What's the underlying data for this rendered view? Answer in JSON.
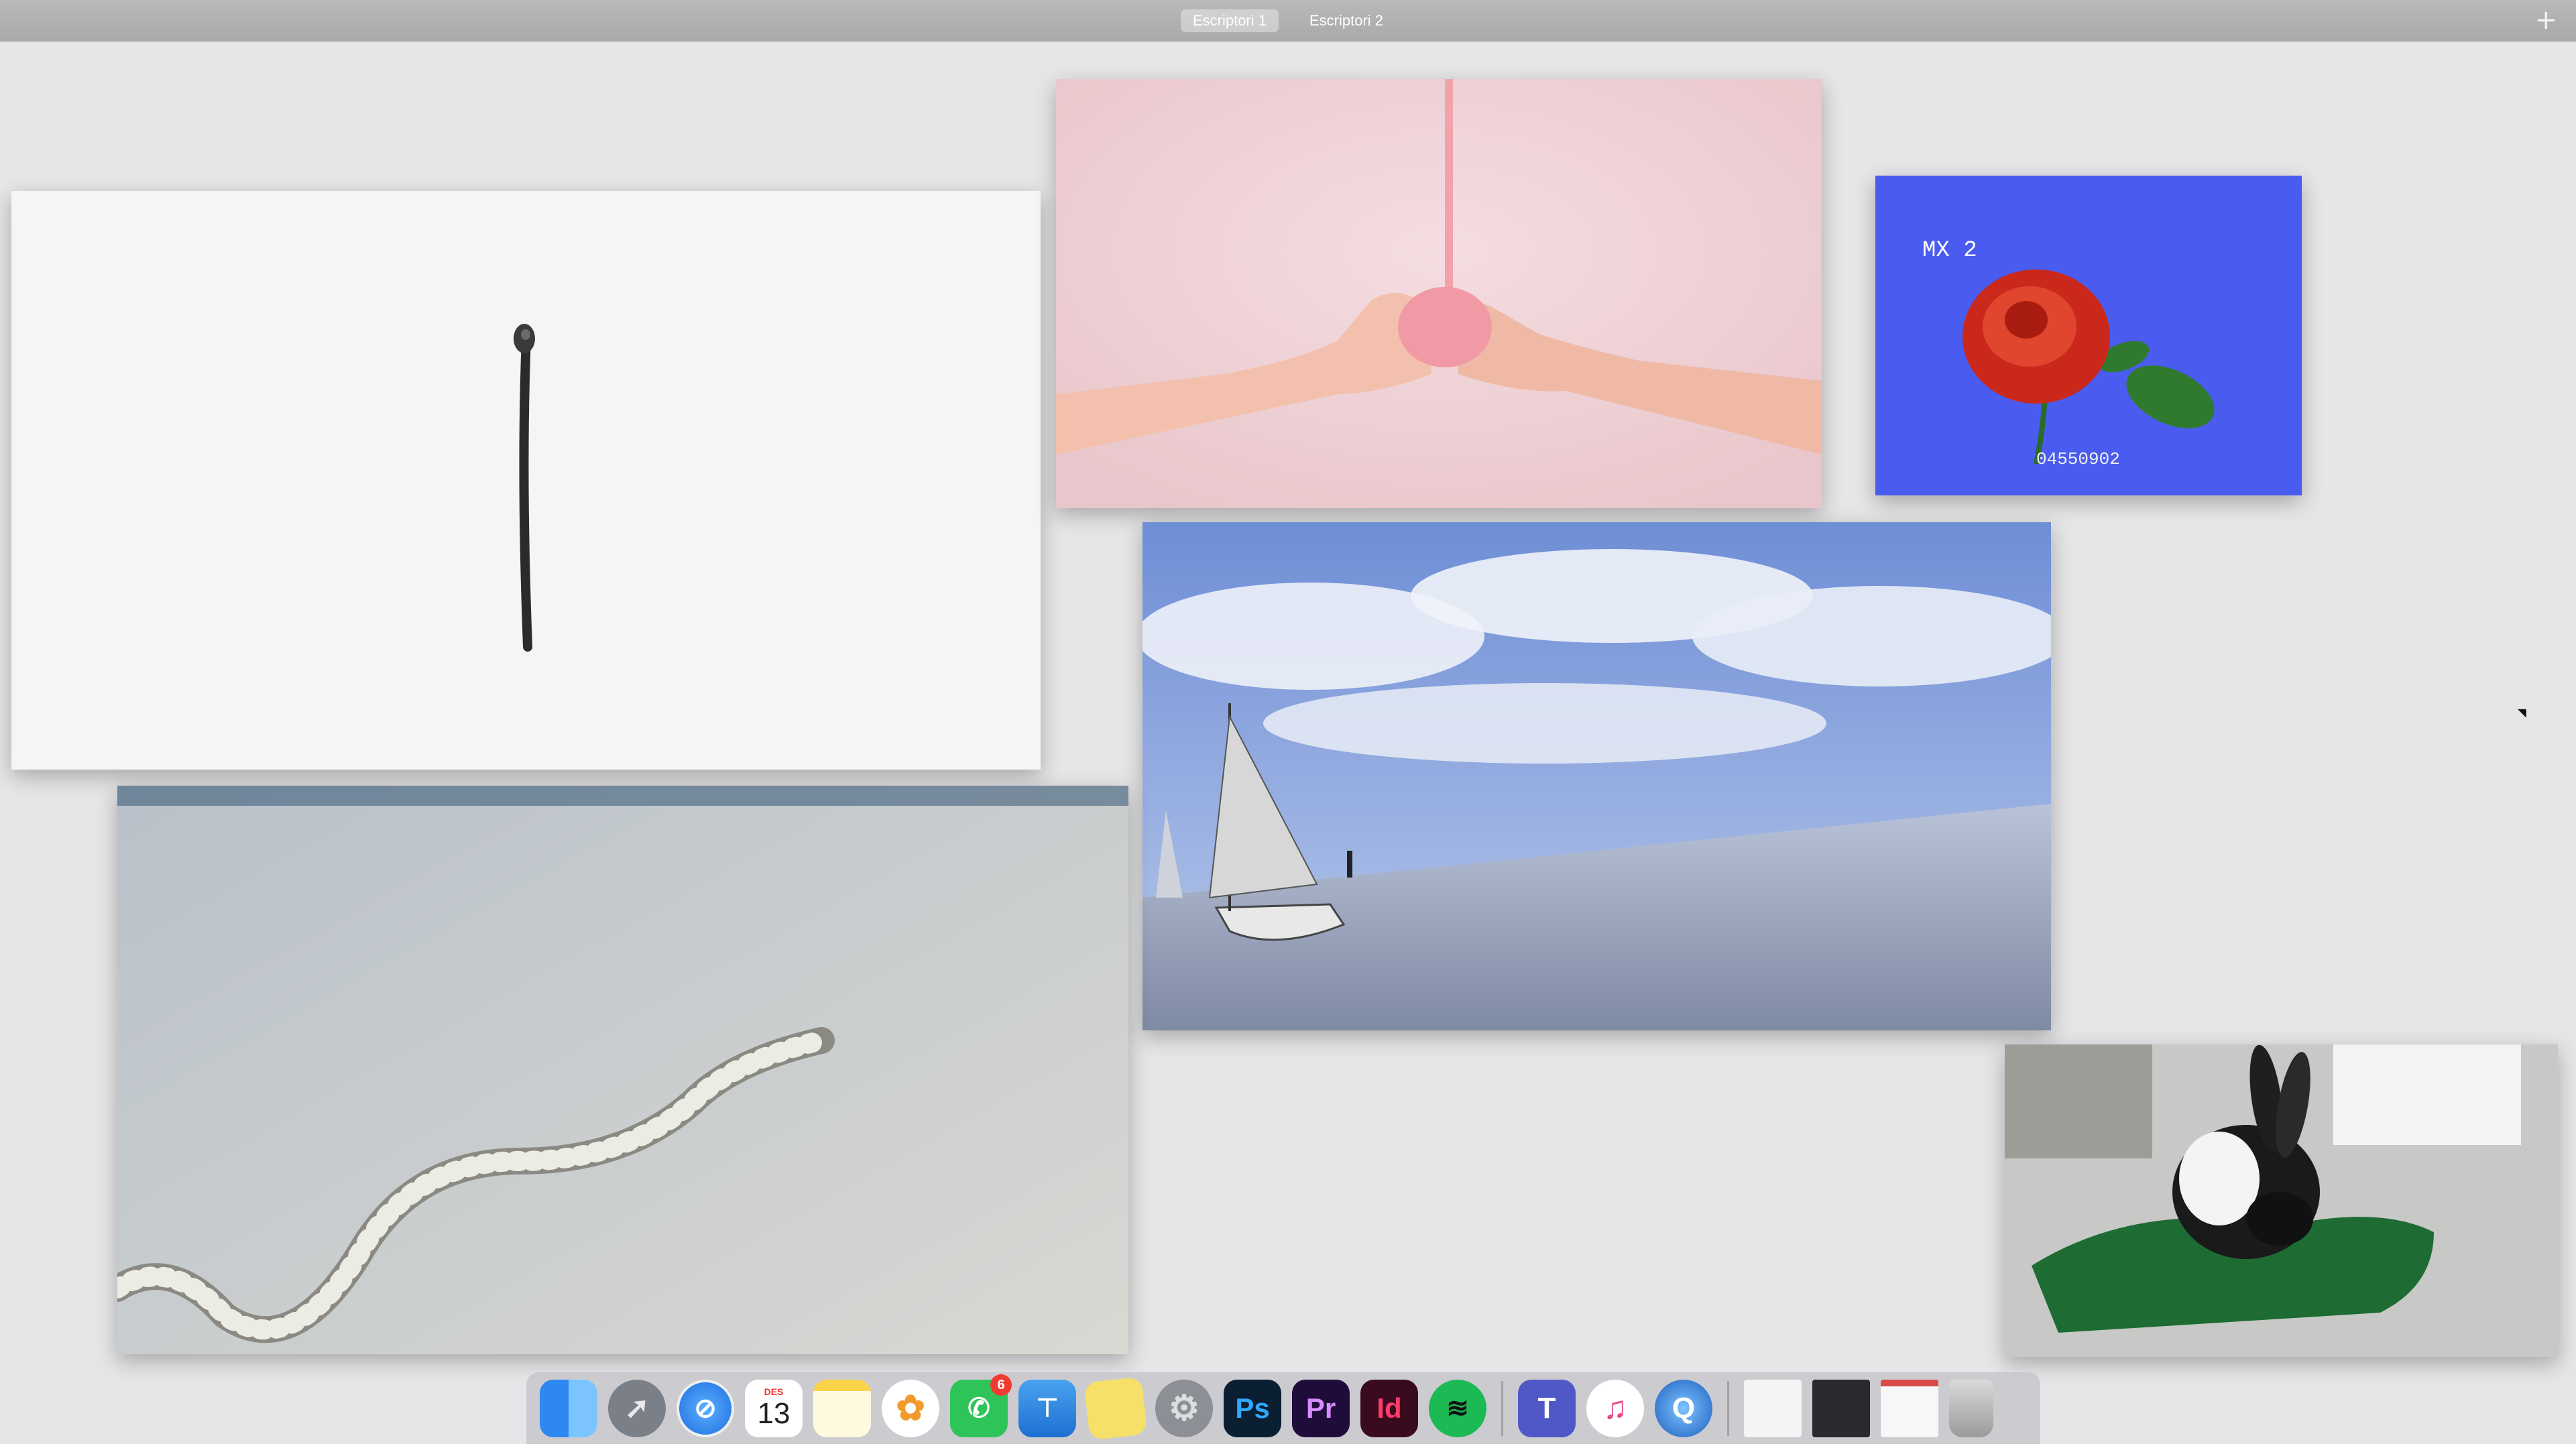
{
  "spaces_bar": {
    "tabs": [
      {
        "label": "Escriptori 1",
        "active": true
      },
      {
        "label": "Escriptori 2",
        "active": false
      }
    ],
    "add_icon": "plus-icon"
  },
  "windows": [
    {
      "name": "burnt-match-window",
      "subject": "burnt-match"
    },
    {
      "name": "pink-slime-hands-window",
      "subject": "hands-pink-slime"
    },
    {
      "name": "vhs-rose-window",
      "subject": "rose",
      "overlay_text": "MX 2",
      "counter_text": "04550902"
    },
    {
      "name": "sailboat-window",
      "subject": "sailboat"
    },
    {
      "name": "eel-window",
      "subject": "sand-eel"
    },
    {
      "name": "rabbit-window",
      "subject": "rabbit"
    }
  ],
  "dock": {
    "calendar": {
      "month": "DES",
      "day": "13"
    },
    "facetime_badge": "6",
    "photoshop_label": "Ps",
    "premiere_label": "Pr",
    "indesign_label": "Id",
    "teams_label": "T",
    "icons": [
      "finder-icon",
      "launchpad-icon",
      "safari-icon",
      "calendar-icon",
      "notes-icon",
      "photos-icon",
      "facetime-icon",
      "keynote-icon",
      "stickies-icon",
      "system-preferences-icon",
      "photoshop-icon",
      "premiere-icon",
      "indesign-icon",
      "spotify-icon",
      "teams-icon",
      "itunes-icon",
      "quicktime-icon",
      "document-thumbnail-icon",
      "premiere-window-thumbnail-icon",
      "browser-window-thumbnail-icon",
      "trash-icon"
    ]
  },
  "colors": {
    "desktop": "#e6e6e8",
    "spaces_bar": "#aeaeb0",
    "rose_bg": "#4a5cf0",
    "rose": "#d8321e"
  }
}
